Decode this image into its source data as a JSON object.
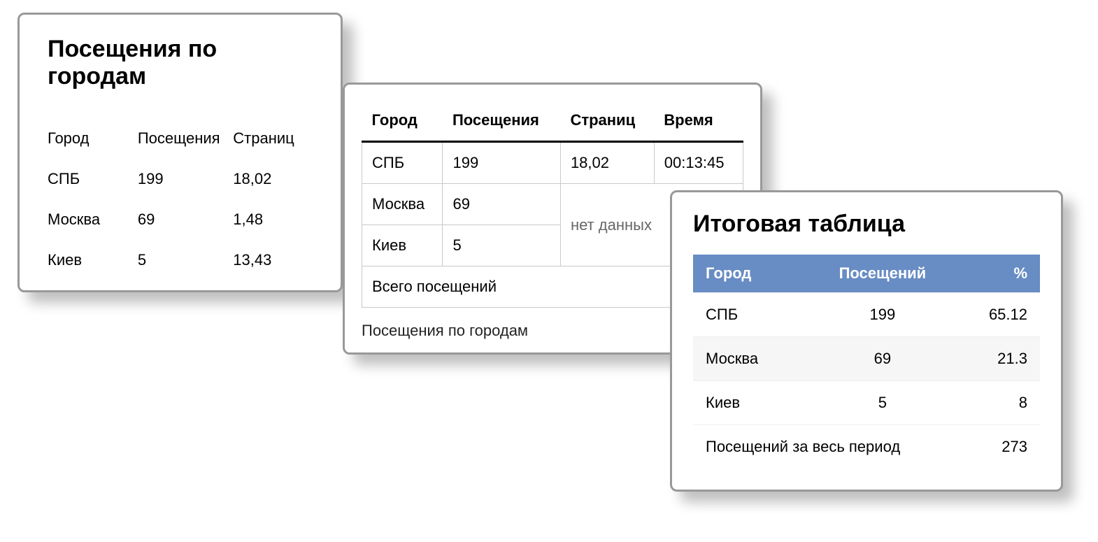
{
  "card1": {
    "title": "Посещения по городам",
    "headers": {
      "city": "Город",
      "visits": "Посещения",
      "pages": "Страниц"
    },
    "rows": [
      {
        "city": "СПБ",
        "visits": "199",
        "pages": "18,02"
      },
      {
        "city": "Москва",
        "visits": "69",
        "pages": "1,48"
      },
      {
        "city": "Киев",
        "visits": "5",
        "pages": "13,43"
      }
    ]
  },
  "card2": {
    "headers": {
      "city": "Город",
      "visits": "Посещения",
      "pages": "Страниц",
      "time": "Время"
    },
    "rows": [
      {
        "city": "СПБ",
        "visits": "199",
        "pages": "18,02",
        "time": "00:13:45"
      },
      {
        "city": "Москва",
        "visits": "69"
      },
      {
        "city": "Киев",
        "visits": "5"
      }
    ],
    "no_data": "нет данных",
    "total_label": "Всего посещений",
    "caption": "Посещения по городам"
  },
  "card3": {
    "title": "Итоговая таблица",
    "headers": {
      "city": "Город",
      "visits": "Посещений",
      "pct": "%"
    },
    "rows": [
      {
        "city": "СПБ",
        "visits": "199",
        "pct": "65.12"
      },
      {
        "city": "Москва",
        "visits": "69",
        "pct": "21.3"
      },
      {
        "city": "Киев",
        "visits": "5",
        "pct": "8"
      }
    ],
    "footer": {
      "label": "Посещений за весь период",
      "value": "273"
    }
  },
  "chart_data": [
    {
      "type": "table",
      "title": "Посещения по городам",
      "columns": [
        "Город",
        "Посещения",
        "Страниц"
      ],
      "rows": [
        [
          "СПБ",
          199,
          18.02
        ],
        [
          "Москва",
          69,
          1.48
        ],
        [
          "Киев",
          5,
          13.43
        ]
      ]
    },
    {
      "type": "table",
      "title": "Посещения по городам",
      "columns": [
        "Город",
        "Посещения",
        "Страниц",
        "Время"
      ],
      "rows": [
        [
          "СПБ",
          199,
          18.02,
          "00:13:45"
        ],
        [
          "Москва",
          69,
          null,
          null
        ],
        [
          "Киев",
          5,
          null,
          null
        ]
      ],
      "footer": [
        "Всего посещений",
        null,
        null,
        null
      ]
    },
    {
      "type": "table",
      "title": "Итоговая таблица",
      "columns": [
        "Город",
        "Посещений",
        "%"
      ],
      "rows": [
        [
          "СПБ",
          199,
          65.12
        ],
        [
          "Москва",
          69,
          21.3
        ],
        [
          "Киев",
          5,
          8
        ]
      ],
      "footer": [
        "Посещений за весь период",
        273
      ]
    }
  ]
}
